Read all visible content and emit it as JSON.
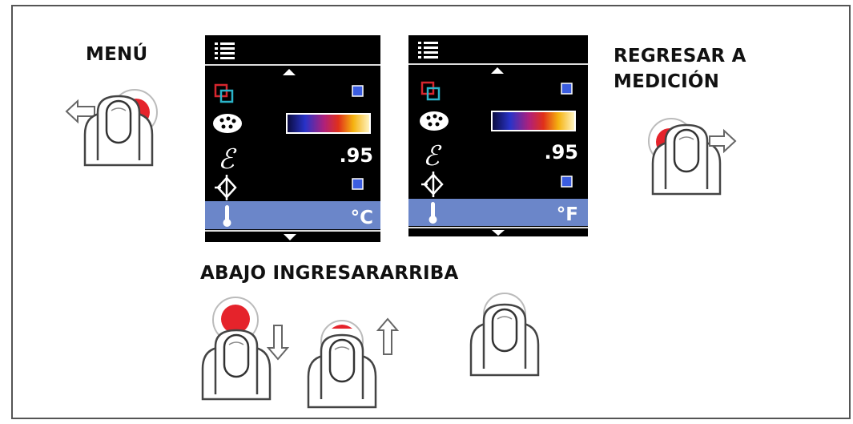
{
  "labels": {
    "menu": "MENÚ",
    "regresar_line1": "REGRESAR A",
    "regresar_line2": "MEDICIÓN",
    "bottom": "ABAJO INGRESARARRIBA"
  },
  "screens": [
    {
      "emissivity": ".95",
      "unit": "°C"
    },
    {
      "emissivity": ".95",
      "unit": "°F"
    }
  ],
  "colors": {
    "screen_bg": "#000000",
    "highlight_row": "#6b86c9",
    "checkbox": "#3b5de0",
    "touch_red": "#e5232b",
    "icon_red": "#d6262e",
    "icon_cyan": "#2bb3c9"
  },
  "icons": [
    "list-icon",
    "up-arrow-icon",
    "down-arrow-icon",
    "color-mode-icon",
    "palette-icon",
    "emissivity-icon",
    "laser-icon",
    "thermometer-icon"
  ]
}
